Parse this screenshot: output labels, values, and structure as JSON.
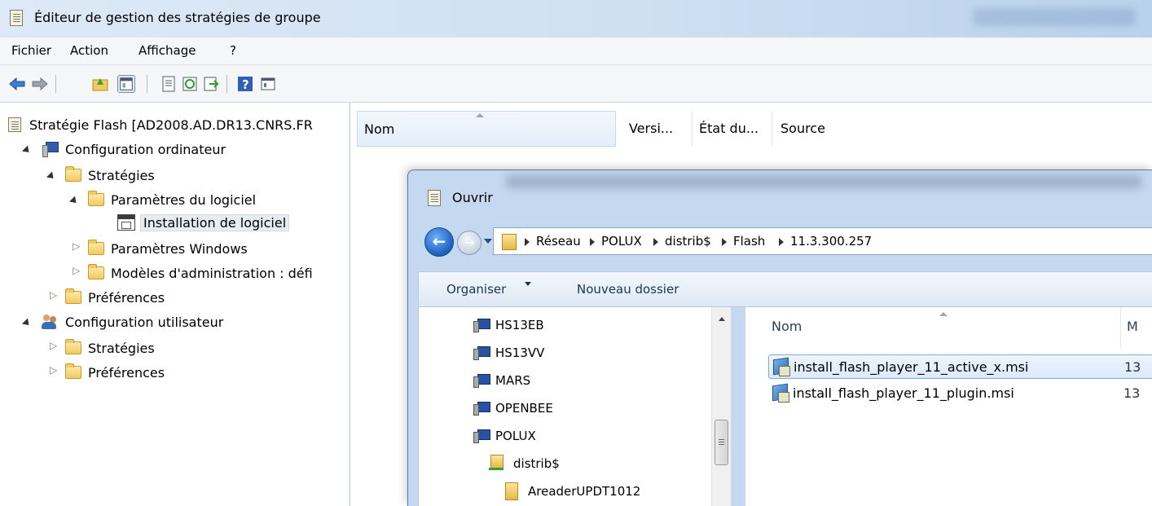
{
  "window": {
    "title": "Éditeur de gestion des stratégies de groupe"
  },
  "menu": [
    "Fichier",
    "Action",
    "Affichage",
    "?"
  ],
  "toolbar": {
    "buttons": [
      "back-arrow-icon",
      "forward-arrow-icon",
      "up-folder-icon",
      "show-tree-icon",
      "properties-icon",
      "refresh-icon",
      "export-icon",
      "help-icon",
      "view-icon"
    ]
  },
  "tree": {
    "root": "Stratégie Flash [AD2008.AD.DR13.CNRS.FR",
    "computer_config": "Configuration ordinateur",
    "strategies": "Stratégies",
    "software_params": "Paramètres du logiciel",
    "software_install": "Installation de logiciel",
    "windows_params": "Paramètres Windows",
    "admin_templates": "Modèles d'administration : défi",
    "preferences": "Préférences",
    "user_config": "Configuration utilisateur",
    "user_strategies": "Stratégies",
    "user_preferences": "Préférences"
  },
  "list": {
    "columns": [
      "Nom",
      "Versi...",
      "État du...",
      "Source"
    ]
  },
  "dialog": {
    "title": "Ouvrir",
    "breadcrumb": [
      "Réseau",
      "POLUX",
      "distrib$",
      "Flash",
      "11.3.300.257"
    ],
    "commands": {
      "organize": "Organiser",
      "new_folder": "Nouveau dossier"
    },
    "nav_items": [
      "HS13EB",
      "HS13VV",
      "MARS",
      "OPENBEE",
      "POLUX",
      "distrib$",
      "AreaderUPDT1012"
    ],
    "file_columns": {
      "name": "Nom",
      "next": "M"
    },
    "files": [
      {
        "name": "install_flash_player_11_active_x.msi",
        "extra": "13"
      },
      {
        "name": "install_flash_player_11_plugin.msi",
        "extra": "13"
      }
    ]
  },
  "colors": {
    "title_bar": "#cfe0f2",
    "selection": "#dbeafb",
    "dialog_frame": "#c4d8ef"
  }
}
